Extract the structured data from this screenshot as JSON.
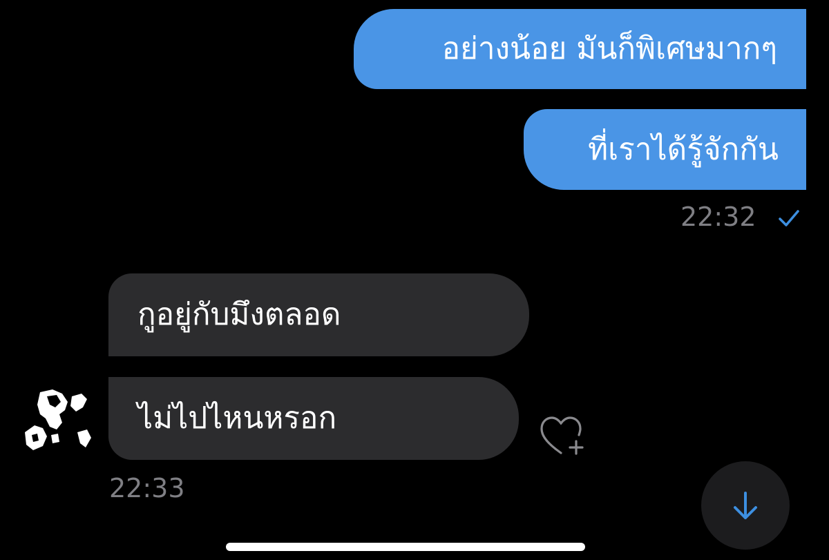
{
  "chat": {
    "outgoing": [
      {
        "text": "อย่างน้อย มันก็พิเศษมากๆ"
      },
      {
        "text": "ที่เราได้รู้จักกัน"
      }
    ],
    "outgoing_time": "22:32",
    "incoming": [
      {
        "text": "กูอยู่กับมึงตลอด"
      },
      {
        "text": "ไม่ไปไหนหรอก"
      }
    ],
    "incoming_time": "22:33"
  },
  "icons": {
    "read_status": "checkmark-icon",
    "react": "heart-plus-icon",
    "scroll": "arrow-down-icon",
    "avatar": "avatar"
  },
  "colors": {
    "background": "#000000",
    "outgoing_bubble": "#4a95e6",
    "incoming_bubble": "#2c2c2e",
    "timestamp": "#7f7f84",
    "accent": "#3d8fe0"
  }
}
